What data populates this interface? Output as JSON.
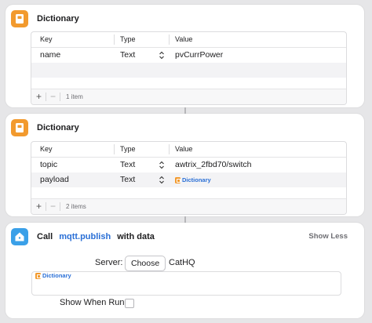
{
  "dictionary_1": {
    "title": "Dictionary",
    "headers": {
      "key": "Key",
      "type": "Type",
      "value": "Value"
    },
    "rows": [
      {
        "key": "name",
        "type": "Text",
        "value": "pvCurrPower"
      }
    ],
    "count": "1 item"
  },
  "dictionary_2": {
    "title": "Dictionary",
    "headers": {
      "key": "Key",
      "type": "Type",
      "value": "Value"
    },
    "rows": [
      {
        "key": "topic",
        "type": "Text",
        "value": "awtrix_2fbd70/switch"
      },
      {
        "key": "payload",
        "type": "Text",
        "value": "Dictionary"
      }
    ],
    "count": "2 items"
  },
  "call": {
    "label": "Call",
    "function": "mqtt.publish",
    "suffix": "with data",
    "show_less": "Show Less",
    "server_label": "Server:",
    "choose_label": "Choose",
    "server_value": "CatHQ",
    "data_variable": "Dictionary",
    "show_when_run_label": "Show When Run:"
  },
  "icons": {
    "dictionary": "dictionary-book-icon",
    "home": "home-assistant-icon"
  },
  "colors": {
    "accent": "#2a6fd6",
    "dictionary_icon": "#f29a2e",
    "home_icon": "#3aa0e8"
  }
}
